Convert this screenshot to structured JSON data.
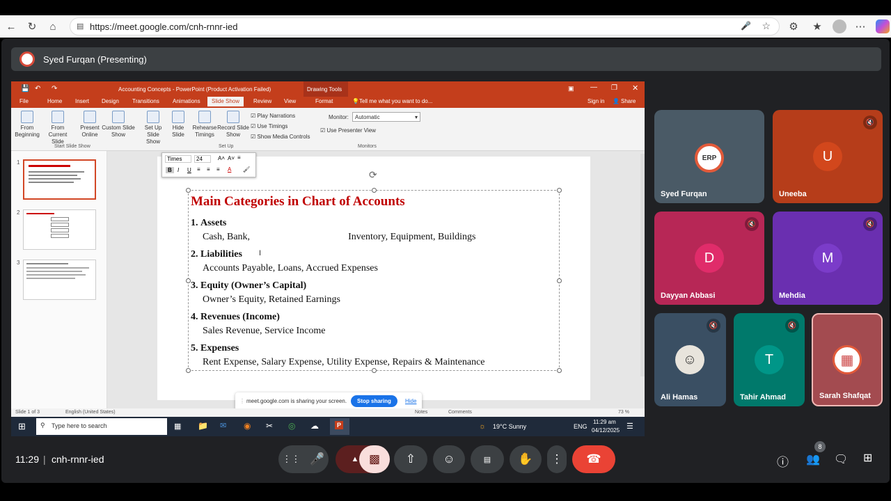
{
  "browser": {
    "url": "https://meet.google.com/cnh-rnnr-ied"
  },
  "meet": {
    "presenting": "Syed Furqan (Presenting)",
    "time": "11:29",
    "separator": "|",
    "meeting_code": "cnh-rnnr-ied",
    "people_count": "8",
    "participants": [
      {
        "name": "Syed Furqan",
        "initial": "ERP",
        "color": "#4a5a66"
      },
      {
        "name": "Uneeba",
        "initial": "U",
        "color": "#b63d1a"
      },
      {
        "name": "Dayyan Abbasi",
        "initial": "D",
        "color": "#b72756"
      },
      {
        "name": "Mehdia",
        "initial": "M",
        "color": "#6a2fb0"
      },
      {
        "name": "Ali Hamas",
        "initial": "",
        "color": "#3a4f63"
      },
      {
        "name": "Tahir Ahmad",
        "initial": "T",
        "color": "#00796b"
      },
      {
        "name": "Sarah Shafqat",
        "initial": "",
        "color": "#a34b50"
      }
    ]
  },
  "ppt": {
    "title": "Accounting Concepts - PowerPoint (Product Activation Failed)",
    "drawing_tools": "Drawing Tools",
    "tabs": [
      "File",
      "Home",
      "Insert",
      "Design",
      "Transitions",
      "Animations",
      "Slide Show",
      "Review",
      "View",
      "Format"
    ],
    "tell_me": "Tell me what you want to do...",
    "sign_in": "Sign in",
    "share": "Share",
    "ribbon": {
      "from_beginning": "From Beginning",
      "from_current": "From Current Slide",
      "present_online": "Present Online",
      "custom_show": "Custom Slide Show",
      "group_start": "Start Slide Show",
      "setup_show": "Set Up Slide Show",
      "hide_slide": "Hide Slide",
      "rehearse": "Rehearse Timings",
      "record": "Record Slide Show",
      "play_narrations": "Play Narrations",
      "use_timings": "Use Timings",
      "show_media": "Show Media Controls",
      "group_setup": "Set Up",
      "monitor_label": "Monitor:",
      "monitor_value": "Automatic",
      "use_presenter": "Use Presenter View",
      "group_monitors": "Monitors"
    },
    "slide_numbers": [
      "1",
      "2",
      "3"
    ],
    "slide": {
      "heading": "Main Categories in Chart of Accounts",
      "items": [
        {
          "num": "1.",
          "title": "Assets",
          "body": "Cash, Bank,",
          "body2": "Inventory, Equipment, Buildings"
        },
        {
          "num": "2.",
          "title": "Liabilities",
          "body": "Accounts Payable, Loans, Accrued Expenses"
        },
        {
          "num": "3.",
          "title": "Equity (Owner’s Capital)",
          "body": "Owner’s Equity, Retained Earnings"
        },
        {
          "num": "4.",
          "title": "Revenues (Income)",
          "body": "Sales Revenue, Service Income"
        },
        {
          "num": "5.",
          "title": "Expenses",
          "body": "Rent Expense, Salary Expense, Utility Expense, Repairs & Maintenance"
        }
      ]
    },
    "mini_toolbar": {
      "font": "Times Ne",
      "size": "24"
    },
    "status": {
      "slide": "Slide 1 of 3",
      "lang": "English (United States)",
      "notes": "Notes",
      "comments": "Comments",
      "zoom": "73 %"
    },
    "share_bar": {
      "text": "meet.google.com is sharing your screen.",
      "stop": "Stop sharing",
      "hide": "Hide"
    },
    "taskbar": {
      "search": "Type here to search",
      "weather": "19°C  Sunny",
      "lang": "ENG",
      "time": "11:29 am",
      "date": "04/12/2025"
    }
  }
}
